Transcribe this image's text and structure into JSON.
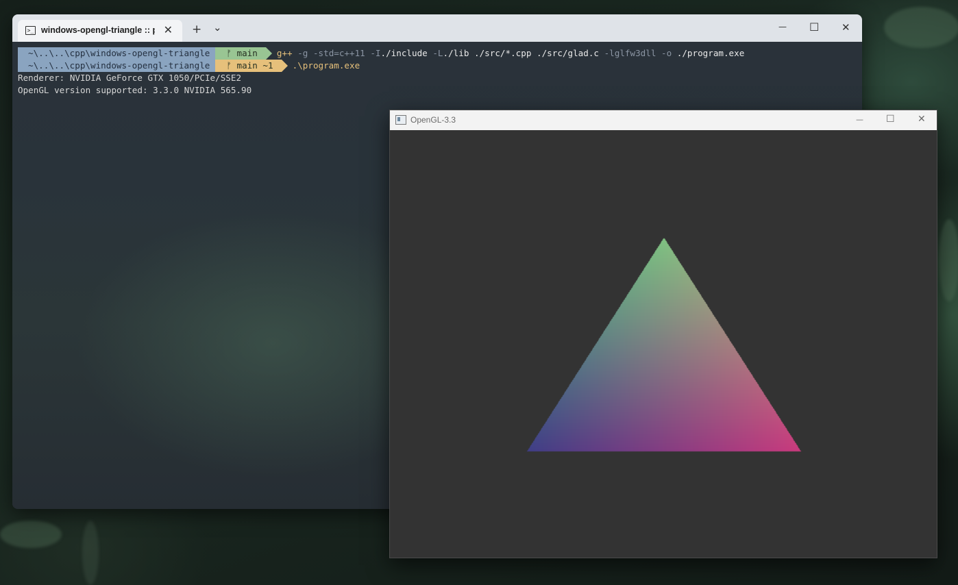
{
  "terminal": {
    "tab_title": "windows-opengl-triangle :: pw",
    "tab_close": "✕",
    "new_tab": "+",
    "dropdown": "⌄",
    "minimize": "—",
    "maximize": "☐",
    "close": "✕",
    "lines": [
      {
        "path": "~\\..\\..\\cpp\\windows-opengl-triangle",
        "branch": " main",
        "command_name": "g++",
        "args": [
          {
            "text": " -g",
            "dim": true
          },
          {
            "text": " -std=c++11",
            "dim": true
          },
          {
            "text": " -I",
            "dim": true
          },
          {
            "text": "./include",
            "dim": false
          },
          {
            "text": " -L",
            "dim": true
          },
          {
            "text": "./lib",
            "dim": false
          },
          {
            "text": " ./src/*.cpp ./src/glad.c",
            "dim": false
          },
          {
            "text": " -lglfw3dll",
            "dim": true
          },
          {
            "text": " -o",
            "dim": true
          },
          {
            "text": " ./program.exe",
            "dim": false
          }
        ]
      },
      {
        "path": "~\\..\\..\\cpp\\windows-opengl-triangle",
        "branch": " main ~1",
        "command_name": ".\\program.exe"
      }
    ],
    "output": [
      "Renderer: NVIDIA GeForce GTX 1050/PCIe/SSE2",
      "OpenGL version supported: 3.3.0 NVIDIA 565.90"
    ]
  },
  "glwindow": {
    "title": "OpenGL-3.3",
    "minimize": "—",
    "maximize": "☐",
    "close": "✕",
    "clear_color": "#333333",
    "triangle_vertex_colors": {
      "top": "#7fc281",
      "bottom_left": "#3f3e86",
      "bottom_right": "#c93a7d"
    }
  },
  "colors": {
    "path_segment": "#8aa4c0",
    "git_clean": "#99c593",
    "git_dirty": "#e6c07b",
    "command": "#e6c07b"
  }
}
